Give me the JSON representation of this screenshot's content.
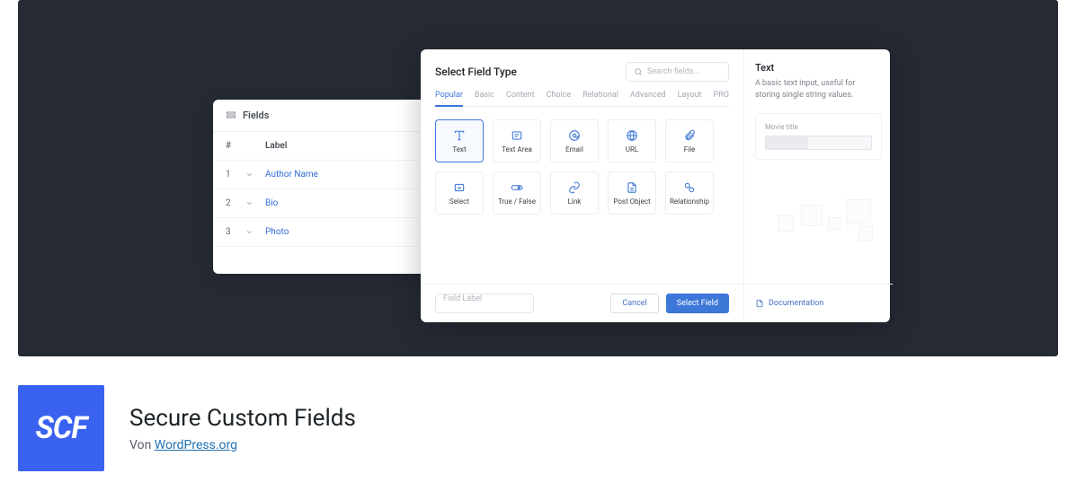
{
  "fields_panel": {
    "title": "Fields",
    "cols": {
      "num": "#",
      "label": "Label"
    },
    "rows": [
      {
        "n": "1",
        "label": "Author Name"
      },
      {
        "n": "2",
        "label": "Bio"
      },
      {
        "n": "3",
        "label": "Photo"
      }
    ]
  },
  "modal": {
    "title": "Select Field Type",
    "search_placeholder": "Search fields...",
    "tabs": [
      "Popular",
      "Basic",
      "Content",
      "Choice",
      "Relational",
      "Advanced",
      "Layout",
      "PRO"
    ],
    "types": [
      {
        "name": "Text"
      },
      {
        "name": "Text Area"
      },
      {
        "name": "Email"
      },
      {
        "name": "URL"
      },
      {
        "name": "File"
      },
      {
        "name": "Select"
      },
      {
        "name": "True / False"
      },
      {
        "name": "Link"
      },
      {
        "name": "Post Object"
      },
      {
        "name": "Relationship"
      }
    ],
    "field_label_placeholder": "Field Label",
    "cancel": "Cancel",
    "select": "Select Field",
    "side": {
      "title": "Text",
      "desc": "A basic text input, useful for storing single string values.",
      "preview_label": "Movie title"
    },
    "doc_link": "Documentation"
  },
  "plugin": {
    "icon_text": "SCF",
    "name": "Secure Custom Fields",
    "by_prefix": "Von ",
    "author": "WordPress.org"
  }
}
